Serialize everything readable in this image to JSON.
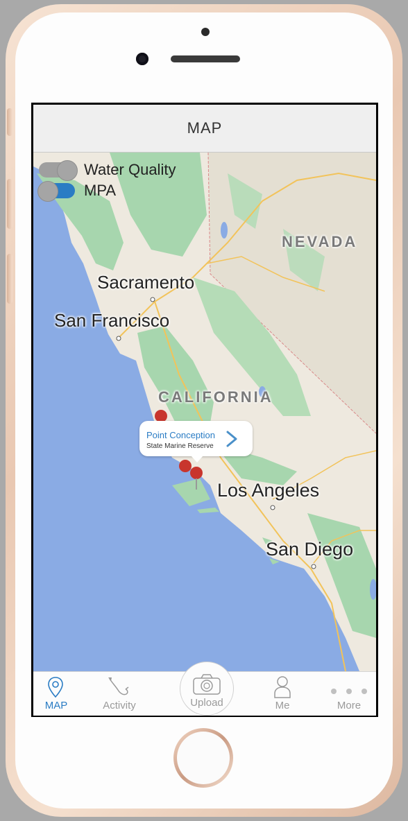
{
  "navbar": {
    "title": "MAP"
  },
  "layers": [
    {
      "label": "Water Quality",
      "on": false
    },
    {
      "label": "MPA",
      "on": true
    }
  ],
  "map": {
    "labels": {
      "nevada": "NEVADA",
      "california": "CALIFORNIA",
      "sacramento": "Sacramento",
      "san_francisco": "San Francisco",
      "los_angeles": "Los Angeles",
      "san_diego": "San Diego"
    },
    "callout": {
      "title": "Point Conception",
      "subtitle": "State Marine Reserve"
    },
    "marker_color": "#c8352d"
  },
  "tabbar": {
    "map": "MAP",
    "activity": "Activity",
    "upload": "Upload",
    "me": "Me",
    "more": "More"
  },
  "colors": {
    "accent": "#2a7cc4",
    "ocean": "#8aabe4",
    "land": "#eee9df",
    "park": "#a7d6ae"
  }
}
